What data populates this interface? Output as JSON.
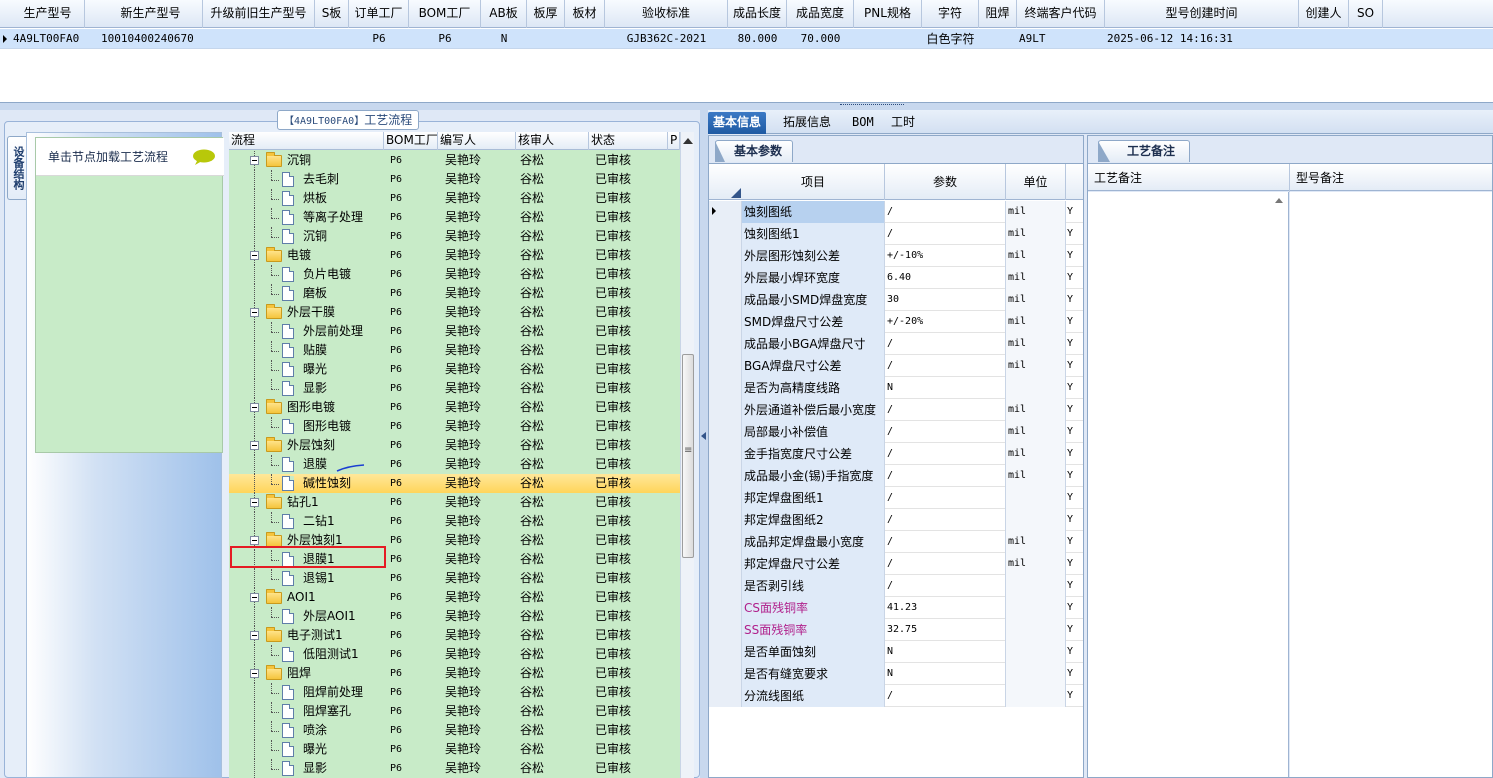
{
  "top_grid": {
    "columns": [
      "生产型号",
      "新生产型号",
      "升级前旧生产型号",
      "S板",
      "订单工厂",
      "BOM工厂",
      "AB板",
      "板厚",
      "板材",
      "验收标准",
      "成品长度",
      "成品宽度",
      "PNL规格",
      "字符",
      "阻焊",
      "终端客户代码",
      "型号创建时间",
      "创建人",
      "SO"
    ],
    "row": [
      "4A9LT00FA0",
      "10010400240670",
      "",
      "",
      "P6",
      "P6",
      "N",
      "",
      "",
      "GJB362C-2021",
      "80.000",
      "70.000",
      "",
      "白色字符",
      "",
      "A9LT",
      "2025-06-12 14:16:31",
      "",
      ""
    ]
  },
  "process_panel": {
    "title_code": "【4A9LT00FA0】",
    "title_text": "工艺流程",
    "vertical_tab": "设备结构",
    "device_hint": "单击节点加载工艺流程",
    "columns": [
      "流程",
      "BOM工厂",
      "编写人",
      "核审人",
      "状态",
      "P"
    ],
    "rows": [
      {
        "name": "沉铜",
        "folder": true,
        "factory": "P6",
        "writer": "吴艳玲",
        "reviewer": "谷松",
        "status": "已审核"
      },
      {
        "name": "去毛刺",
        "folder": false,
        "factory": "P6",
        "writer": "吴艳玲",
        "reviewer": "谷松",
        "status": "已审核"
      },
      {
        "name": "烘板",
        "folder": false,
        "factory": "P6",
        "writer": "吴艳玲",
        "reviewer": "谷松",
        "status": "已审核"
      },
      {
        "name": "等离子处理",
        "folder": false,
        "factory": "P6",
        "writer": "吴艳玲",
        "reviewer": "谷松",
        "status": "已审核"
      },
      {
        "name": "沉铜",
        "folder": false,
        "factory": "P6",
        "writer": "吴艳玲",
        "reviewer": "谷松",
        "status": "已审核"
      },
      {
        "name": "电镀",
        "folder": true,
        "factory": "P6",
        "writer": "吴艳玲",
        "reviewer": "谷松",
        "status": "已审核"
      },
      {
        "name": "负片电镀",
        "folder": false,
        "factory": "P6",
        "writer": "吴艳玲",
        "reviewer": "谷松",
        "status": "已审核"
      },
      {
        "name": "磨板",
        "folder": false,
        "factory": "P6",
        "writer": "吴艳玲",
        "reviewer": "谷松",
        "status": "已审核"
      },
      {
        "name": "外层干膜",
        "folder": true,
        "factory": "P6",
        "writer": "吴艳玲",
        "reviewer": "谷松",
        "status": "已审核"
      },
      {
        "name": "外层前处理",
        "folder": false,
        "factory": "P6",
        "writer": "吴艳玲",
        "reviewer": "谷松",
        "status": "已审核"
      },
      {
        "name": "贴膜",
        "folder": false,
        "factory": "P6",
        "writer": "吴艳玲",
        "reviewer": "谷松",
        "status": "已审核"
      },
      {
        "name": "曝光",
        "folder": false,
        "factory": "P6",
        "writer": "吴艳玲",
        "reviewer": "谷松",
        "status": "已审核"
      },
      {
        "name": "显影",
        "folder": false,
        "factory": "P6",
        "writer": "吴艳玲",
        "reviewer": "谷松",
        "status": "已审核"
      },
      {
        "name": "图形电镀",
        "folder": true,
        "factory": "P6",
        "writer": "吴艳玲",
        "reviewer": "谷松",
        "status": "已审核"
      },
      {
        "name": "图形电镀",
        "folder": false,
        "factory": "P6",
        "writer": "吴艳玲",
        "reviewer": "谷松",
        "status": "已审核"
      },
      {
        "name": "外层蚀刻",
        "folder": true,
        "factory": "P6",
        "writer": "吴艳玲",
        "reviewer": "谷松",
        "status": "已审核"
      },
      {
        "name": "退膜",
        "folder": false,
        "factory": "P6",
        "writer": "吴艳玲",
        "reviewer": "谷松",
        "status": "已审核"
      },
      {
        "name": "碱性蚀刻",
        "folder": false,
        "factory": "P6",
        "writer": "吴艳玲",
        "reviewer": "谷松",
        "status": "已审核",
        "selected": true
      },
      {
        "name": "钻孔1",
        "folder": true,
        "factory": "P6",
        "writer": "吴艳玲",
        "reviewer": "谷松",
        "status": "已审核"
      },
      {
        "name": "二钻1",
        "folder": false,
        "factory": "P6",
        "writer": "吴艳玲",
        "reviewer": "谷松",
        "status": "已审核"
      },
      {
        "name": "外层蚀刻1",
        "folder": true,
        "factory": "P6",
        "writer": "吴艳玲",
        "reviewer": "谷松",
        "status": "已审核"
      },
      {
        "name": "退膜1",
        "folder": false,
        "factory": "P6",
        "writer": "吴艳玲",
        "reviewer": "谷松",
        "status": "已审核"
      },
      {
        "name": "退锡1",
        "folder": false,
        "factory": "P6",
        "writer": "吴艳玲",
        "reviewer": "谷松",
        "status": "已审核"
      },
      {
        "name": "AOI1",
        "folder": true,
        "factory": "P6",
        "writer": "吴艳玲",
        "reviewer": "谷松",
        "status": "已审核"
      },
      {
        "name": "外层AOI1",
        "folder": false,
        "factory": "P6",
        "writer": "吴艳玲",
        "reviewer": "谷松",
        "status": "已审核"
      },
      {
        "name": "电子测试1",
        "folder": true,
        "factory": "P6",
        "writer": "吴艳玲",
        "reviewer": "谷松",
        "status": "已审核"
      },
      {
        "name": "低阻测试1",
        "folder": false,
        "factory": "P6",
        "writer": "吴艳玲",
        "reviewer": "谷松",
        "status": "已审核"
      },
      {
        "name": "阻焊",
        "folder": true,
        "factory": "P6",
        "writer": "吴艳玲",
        "reviewer": "谷松",
        "status": "已审核"
      },
      {
        "name": "阻焊前处理",
        "folder": false,
        "factory": "P6",
        "writer": "吴艳玲",
        "reviewer": "谷松",
        "status": "已审核"
      },
      {
        "name": "阻焊塞孔",
        "folder": false,
        "factory": "P6",
        "writer": "吴艳玲",
        "reviewer": "谷松",
        "status": "已审核"
      },
      {
        "name": "喷涂",
        "folder": false,
        "factory": "P6",
        "writer": "吴艳玲",
        "reviewer": "谷松",
        "status": "已审核"
      },
      {
        "name": "曝光",
        "folder": false,
        "factory": "P6",
        "writer": "吴艳玲",
        "reviewer": "谷松",
        "status": "已审核"
      },
      {
        "name": "显影",
        "folder": false,
        "factory": "P6",
        "writer": "吴艳玲",
        "reviewer": "谷松",
        "status": "已审核"
      }
    ]
  },
  "right_tabs": [
    "基本信息",
    "拓展信息",
    "BOM",
    "工时"
  ],
  "basic_params": {
    "tab": "基本参数",
    "columns": [
      "项目",
      "参数",
      "单位"
    ],
    "rows": [
      {
        "item": "蚀刻图纸",
        "param": "/",
        "unit": "mil",
        "flag": "Y",
        "selected": true
      },
      {
        "item": "蚀刻图纸1",
        "param": "/",
        "unit": "mil",
        "flag": "Y"
      },
      {
        "item": "外层图形蚀刻公差",
        "param": "+/-10%",
        "unit": "mil",
        "flag": "Y"
      },
      {
        "item": "外层最小焊环宽度",
        "param": "6.40",
        "unit": "mil",
        "flag": "Y"
      },
      {
        "item": "成品最小SMD焊盘宽度",
        "param": "30",
        "unit": "mil",
        "flag": "Y"
      },
      {
        "item": "SMD焊盘尺寸公差",
        "param": "+/-20%",
        "unit": "mil",
        "flag": "Y"
      },
      {
        "item": "成品最小BGA焊盘尺寸",
        "param": "/",
        "unit": "mil",
        "flag": "Y"
      },
      {
        "item": "BGA焊盘尺寸公差",
        "param": "/",
        "unit": "mil",
        "flag": "Y"
      },
      {
        "item": "是否为高精度线路",
        "param": "N",
        "unit": "",
        "flag": "Y"
      },
      {
        "item": "外层通道补偿后最小宽度",
        "param": "/",
        "unit": "mil",
        "flag": "Y"
      },
      {
        "item": "局部最小补偿值",
        "param": "/",
        "unit": "mil",
        "flag": "Y"
      },
      {
        "item": "金手指宽度尺寸公差",
        "param": "/",
        "unit": "mil",
        "flag": "Y"
      },
      {
        "item": "成品最小金(锡)手指宽度",
        "param": "/",
        "unit": "mil",
        "flag": "Y"
      },
      {
        "item": "邦定焊盘图纸1",
        "param": "/",
        "unit": "",
        "flag": "Y"
      },
      {
        "item": "邦定焊盘图纸2",
        "param": "/",
        "unit": "",
        "flag": "Y"
      },
      {
        "item": "成品邦定焊盘最小宽度",
        "param": "/",
        "unit": "mil",
        "flag": "Y"
      },
      {
        "item": "邦定焊盘尺寸公差",
        "param": "/",
        "unit": "mil",
        "flag": "Y"
      },
      {
        "item": "是否剥引线",
        "param": "/",
        "unit": "",
        "flag": "Y"
      },
      {
        "item": "CS面残铜率",
        "param": "41.23",
        "unit": "",
        "flag": "Y",
        "purple": true
      },
      {
        "item": "SS面残铜率",
        "param": "32.75",
        "unit": "",
        "flag": "Y",
        "purple": true
      },
      {
        "item": "是否单面蚀刻",
        "param": "N",
        "unit": "",
        "flag": "Y"
      },
      {
        "item": "是否有缝宽要求",
        "param": "N",
        "unit": "",
        "flag": "Y"
      },
      {
        "item": "分流线图纸",
        "param": "/",
        "unit": "",
        "flag": "Y"
      }
    ]
  },
  "notes": {
    "tab": "工艺备注",
    "columns": [
      "工艺备注",
      "型号备注"
    ]
  }
}
